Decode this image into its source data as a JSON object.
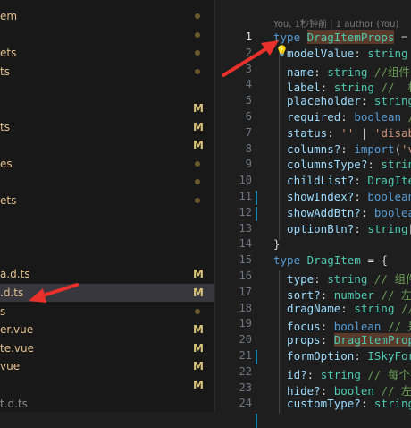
{
  "explorer": {
    "files": [
      {
        "name": "em",
        "color": "#e2c08d",
        "badge": "dot"
      },
      {
        "name": "",
        "color": "#cccccc",
        "badge": "dot"
      },
      {
        "name": "ets",
        "color": "#e2c08d",
        "badge": "dot"
      },
      {
        "name": "ts",
        "color": "#e2c08d",
        "badge": "dot"
      },
      {
        "name": "",
        "color": "#cccccc",
        "badge": ""
      },
      {
        "name": "",
        "color": "#cccccc",
        "badge": "M"
      },
      {
        "name": "ts",
        "color": "#e2c08d",
        "badge": "M"
      },
      {
        "name": "",
        "color": "#cccccc",
        "badge": "M"
      },
      {
        "name": "es",
        "color": "#e2c08d",
        "badge": "dot"
      },
      {
        "name": "",
        "color": "#cccccc",
        "badge": "dot"
      },
      {
        "name": "ets",
        "color": "#e2c08d",
        "badge": "dot"
      },
      {
        "name": "",
        "color": "#cccccc",
        "badge": ""
      },
      {
        "name": "",
        "color": "#cccccc",
        "badge": ""
      },
      {
        "name": "",
        "color": "#cccccc",
        "badge": ""
      },
      {
        "name": "a.d.ts",
        "color": "#e2c08d",
        "badge": "M"
      },
      {
        "name": ".d.ts",
        "color": "#e2c08d",
        "badge": "M"
      },
      {
        "name": "s",
        "color": "#e2c08d",
        "badge": "dot"
      },
      {
        "name": "er.vue",
        "color": "#e2c08d",
        "badge": "M"
      },
      {
        "name": "te.vue",
        "color": "#e2c08d",
        "badge": "M"
      },
      {
        "name": "vue",
        "color": "#e2c08d",
        "badge": "M"
      },
      {
        "name": "",
        "color": "#cccccc",
        "badge": "M"
      },
      {
        "name": "t.d.ts",
        "color": "#8a8a8a",
        "badge": ""
      }
    ],
    "selected_index": 15
  },
  "editor": {
    "blame": "You, 1秒钟前 | 1 author (You)",
    "current_line": 1,
    "modified_lines": [
      11,
      12,
      21,
      25
    ],
    "lines": [
      {
        "n": "1",
        "tokens": [
          [
            "kw",
            "type "
          ],
          [
            "ty hl",
            "DragItemProps"
          ],
          [
            "punc",
            " = {"
          ]
        ]
      },
      {
        "n": "2",
        "tokens": [
          [
            "prop",
            "  modelValue"
          ],
          [
            "punc",
            ": "
          ],
          [
            "ty",
            "string"
          ]
        ]
      },
      {
        "n": "3",
        "tokens": [
          [
            "prop",
            "  name"
          ],
          [
            "punc",
            ": "
          ],
          [
            "ty",
            "string "
          ],
          [
            "cm",
            "//组件名"
          ]
        ]
      },
      {
        "n": "4",
        "tokens": [
          [
            "prop",
            "  label"
          ],
          [
            "punc",
            ": "
          ],
          [
            "ty",
            "string "
          ],
          [
            "cm",
            "//  标"
          ]
        ]
      },
      {
        "n": "5",
        "tokens": [
          [
            "prop",
            "  placeholder"
          ],
          [
            "punc",
            ": "
          ],
          [
            "ty",
            "string"
          ]
        ]
      },
      {
        "n": "6",
        "tokens": [
          [
            "prop",
            "  required"
          ],
          [
            "punc",
            ": "
          ],
          [
            "kw",
            "boolean "
          ],
          [
            "cm",
            "//"
          ]
        ]
      },
      {
        "n": "7",
        "tokens": [
          [
            "prop",
            "  status"
          ],
          [
            "punc",
            ": "
          ],
          [
            "st",
            "'' "
          ],
          [
            "punc",
            "| "
          ],
          [
            "st",
            "'disab"
          ]
        ]
      },
      {
        "n": "8",
        "tokens": [
          [
            "prop",
            "  columns?"
          ],
          [
            "punc",
            ": "
          ],
          [
            "kw",
            "import"
          ],
          [
            "punc",
            "("
          ],
          [
            "st",
            "'va"
          ]
        ]
      },
      {
        "n": "9",
        "tokens": [
          [
            "prop",
            "  columnsType?"
          ],
          [
            "punc",
            ": "
          ],
          [
            "ty",
            "string"
          ]
        ]
      },
      {
        "n": "10",
        "tokens": [
          [
            "prop",
            "  childList?"
          ],
          [
            "punc",
            ": "
          ],
          [
            "ty",
            "DragIten"
          ]
        ]
      },
      {
        "n": "11",
        "tokens": [
          [
            "prop",
            "  showIndex?"
          ],
          [
            "punc",
            ": "
          ],
          [
            "kw",
            "boolean"
          ]
        ]
      },
      {
        "n": "12",
        "tokens": [
          [
            "prop",
            "  showAddBtn?"
          ],
          [
            "punc",
            ": "
          ],
          [
            "kw",
            "boolean"
          ]
        ]
      },
      {
        "n": "13",
        "tokens": [
          [
            "prop",
            "  optionBtn?"
          ],
          [
            "punc",
            ": "
          ],
          [
            "ty",
            "string"
          ],
          [
            "punc",
            "["
          ]
        ]
      },
      {
        "n": "14",
        "tokens": [
          [
            "punc",
            "}"
          ]
        ]
      },
      {
        "n": "15",
        "tokens": [
          [
            "kw",
            "type "
          ],
          [
            "ty",
            "DragItem"
          ],
          [
            "punc",
            " = {"
          ]
        ]
      },
      {
        "n": "16",
        "tokens": [
          [
            "prop",
            "  type"
          ],
          [
            "punc",
            ": "
          ],
          [
            "ty",
            "string "
          ],
          [
            "cm",
            "// 组件"
          ]
        ]
      },
      {
        "n": "17",
        "tokens": [
          [
            "prop",
            "  sort?"
          ],
          [
            "punc",
            ": "
          ],
          [
            "ty",
            "number "
          ],
          [
            "cm",
            "// 左侧"
          ]
        ]
      },
      {
        "n": "18",
        "tokens": [
          [
            "prop",
            "  dragName"
          ],
          [
            "punc",
            ": "
          ],
          [
            "ty",
            "string "
          ],
          [
            "cm",
            "//"
          ]
        ]
      },
      {
        "n": "19",
        "tokens": [
          [
            "prop",
            "  focus"
          ],
          [
            "punc",
            ": "
          ],
          [
            "kw",
            "boolean "
          ],
          [
            "cm",
            "// 是"
          ]
        ]
      },
      {
        "n": "20",
        "tokens": [
          [
            "prop",
            "  props"
          ],
          [
            "punc",
            ": "
          ],
          [
            "ty hl",
            "DragItemProps"
          ]
        ]
      },
      {
        "n": "21",
        "tokens": [
          [
            "prop",
            "  formOption"
          ],
          [
            "punc",
            ": "
          ],
          [
            "ty",
            "ISkyForm"
          ]
        ]
      },
      {
        "n": "22",
        "tokens": [
          [
            "prop",
            "  id?"
          ],
          [
            "punc",
            ": "
          ],
          [
            "ty",
            "string "
          ],
          [
            "cm",
            "// 每个不"
          ]
        ]
      },
      {
        "n": "23",
        "tokens": [
          [
            "prop",
            "  hide?"
          ],
          [
            "punc",
            ": "
          ],
          [
            "ty",
            "boolen "
          ],
          [
            "cm",
            "// 左侧"
          ]
        ]
      },
      {
        "n": "24",
        "tokens": [
          [
            "prop",
            "  customType?"
          ],
          [
            "punc",
            ": "
          ],
          [
            "ty",
            "string"
          ]
        ]
      }
    ]
  },
  "annotations": {
    "arrow_color": "#e8312a"
  }
}
